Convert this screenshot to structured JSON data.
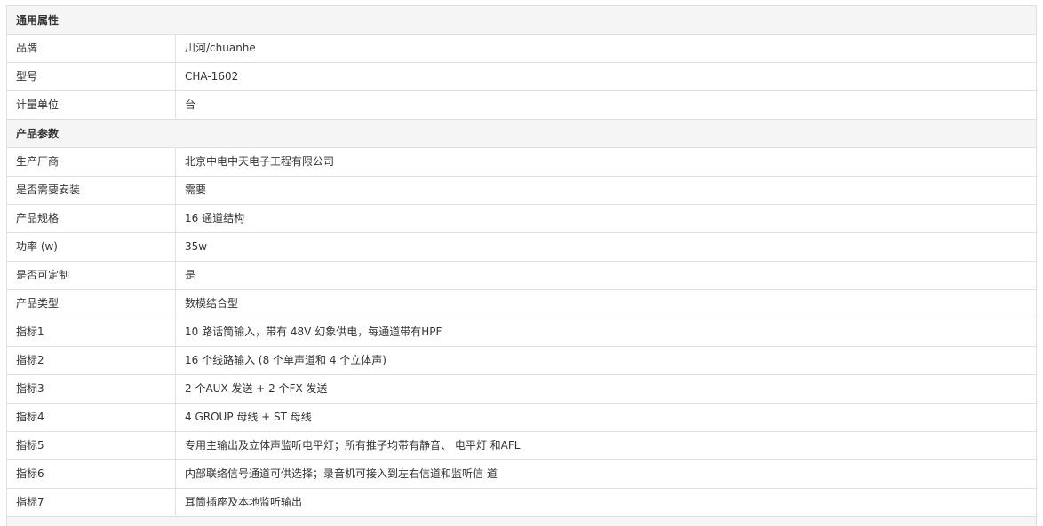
{
  "sections": [
    {
      "title": "通用属性",
      "rows": [
        {
          "label": "品牌",
          "value": "川河/chuanhe"
        },
        {
          "label": "型号",
          "value": "CHA-1602"
        },
        {
          "label": "计量单位",
          "value": "台"
        }
      ]
    },
    {
      "title": "产品参数",
      "rows": [
        {
          "label": "生产厂商",
          "value": "北京中电中天电子工程有限公司"
        },
        {
          "label": "是否需要安装",
          "value": "需要"
        },
        {
          "label": "产品规格",
          "value": "16 通道结构"
        },
        {
          "label": "功率 (w)",
          "value": "35w"
        },
        {
          "label": "是否可定制",
          "value": "是"
        },
        {
          "label": "产品类型",
          "value": "数模结合型"
        },
        {
          "label": "指标1",
          "value": "10 路话筒输入，带有 48V 幻象供电，每通道带有HPF"
        },
        {
          "label": "指标2",
          "value": "16 个线路输入 (8 个单声道和 4 个立体声)"
        },
        {
          "label": "指标3",
          "value": "2 个AUX 发送 + 2 个FX 发送"
        },
        {
          "label": "指标4",
          "value": "4 GROUP 母线 + ST 母线"
        },
        {
          "label": "指标5",
          "value": "专用主输出及立体声监听电平灯；所有推子均带有静音、 电平灯 和AFL"
        },
        {
          "label": "指标6",
          "value": "内部联络信号通道可供选择；录音机可接入到左右信道和监听信 道"
        },
        {
          "label": "指标7",
          "value": "耳筒插座及本地监听输出"
        }
      ]
    }
  ]
}
